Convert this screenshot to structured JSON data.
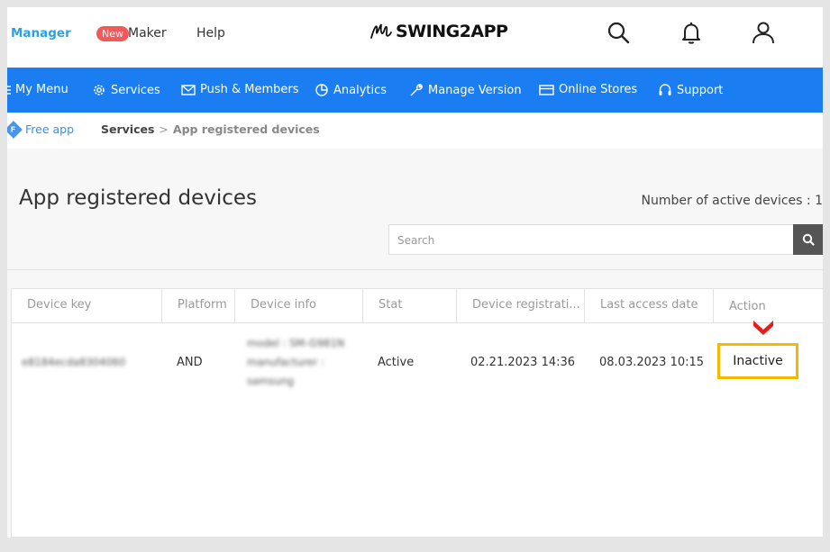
{
  "topbar": {
    "manager_label": "Manager",
    "new_badge": "New",
    "maker_label": "Maker",
    "help_label": "Help",
    "logo_text": "SWING2APP",
    "icons": [
      "search-icon",
      "bell-icon",
      "user-icon"
    ]
  },
  "nav": {
    "items": [
      {
        "label": "My Menu",
        "icon": "menu-icon"
      },
      {
        "label": "Services",
        "icon": "gear-icon"
      },
      {
        "label": "Push & Members",
        "icon": "mail-icon"
      },
      {
        "label": "Analytics",
        "icon": "pie-chart-icon"
      },
      {
        "label": "Manage Version",
        "icon": "wrench-icon"
      },
      {
        "label": "Online Stores",
        "icon": "card-icon"
      },
      {
        "label": "Support",
        "icon": "headset-icon"
      }
    ]
  },
  "breadcrumb": {
    "app_badge": "F",
    "app_label": "Free app",
    "section": "Services",
    "separator": ">",
    "current": "App registered devices"
  },
  "page": {
    "title": "App registered devices",
    "active_devices_label": "Number of active devices : 1",
    "search_placeholder": "Search"
  },
  "table": {
    "columns": [
      "Device key",
      "Platform",
      "Device info",
      "Stat",
      "Device registrati...",
      "Last access date",
      "Action"
    ],
    "rows": [
      {
        "device_key": "e8184ecda8304060",
        "platform": "AND",
        "device_info": [
          "model : SM-G981N",
          "manufacturer :",
          "samsung"
        ],
        "stat": "Active",
        "registration": "02.21.2023 14:36",
        "last_access": "08.03.2023 10:15",
        "action": "Inactive"
      }
    ]
  },
  "colors": {
    "nav_bg": "#1a7ef2",
    "highlight_border": "#f5b800",
    "arrow": "#e81c1c",
    "new_badge": "#f05a5a"
  }
}
